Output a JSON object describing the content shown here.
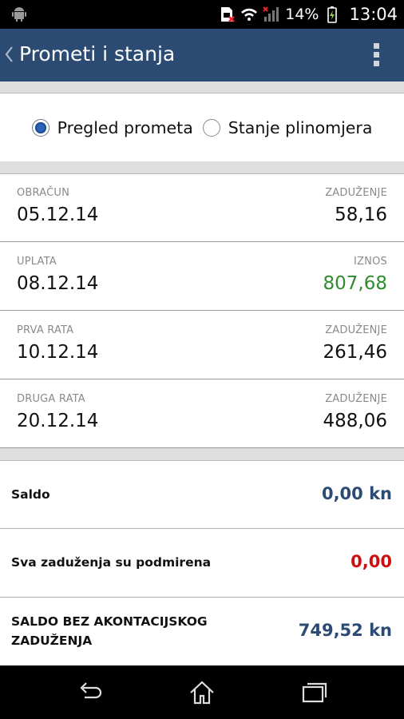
{
  "status_bar": {
    "battery_percent": "14%",
    "time": "13:04",
    "icons": [
      "android-icon",
      "sim-error-icon",
      "wifi-icon",
      "signal-icon",
      "battery-charging-icon"
    ]
  },
  "action_bar": {
    "title": "Prometi i stanja",
    "back_icon": "chevron-left-icon",
    "menu_icon": "overflow-menu-icon"
  },
  "view_options": [
    {
      "label": "Pregled prometa",
      "selected": true
    },
    {
      "label": "Stanje plinomjera",
      "selected": false
    }
  ],
  "transactions": [
    {
      "type": "OBRAČUN",
      "date": "05.12.14",
      "amount_label": "ZADUŽENJE",
      "amount": "58,16",
      "amount_color": "#111111"
    },
    {
      "type": "UPLATA",
      "date": "08.12.14",
      "amount_label": "IZNOS",
      "amount": "807,68",
      "amount_color": "#2e8b2e"
    },
    {
      "type": "PRVA RATA",
      "date": "10.12.14",
      "amount_label": "ZADUŽENJE",
      "amount": "261,46",
      "amount_color": "#111111"
    },
    {
      "type": "DRUGA RATA",
      "date": "20.12.14",
      "amount_label": "ZADUŽENJE",
      "amount": "488,06",
      "amount_color": "#111111"
    }
  ],
  "summary": {
    "saldo_label": "Saldo",
    "saldo_value": "0,00 kn",
    "debts_label": "Sva zaduženja su podmirena",
    "debts_value": "0,00",
    "saldo_bez_line1": "SALDO BEZ AKONTACIJSKOG",
    "saldo_bez_line2": "ZADUŽENJA",
    "saldo_bez_value": "749,52 kn"
  },
  "colors": {
    "accent": "#2b4b73",
    "positive": "#2e8b2e",
    "negative": "#cc0f0f"
  },
  "nav_bar": {
    "icons": [
      "back-icon",
      "home-icon",
      "recent-apps-icon"
    ]
  }
}
